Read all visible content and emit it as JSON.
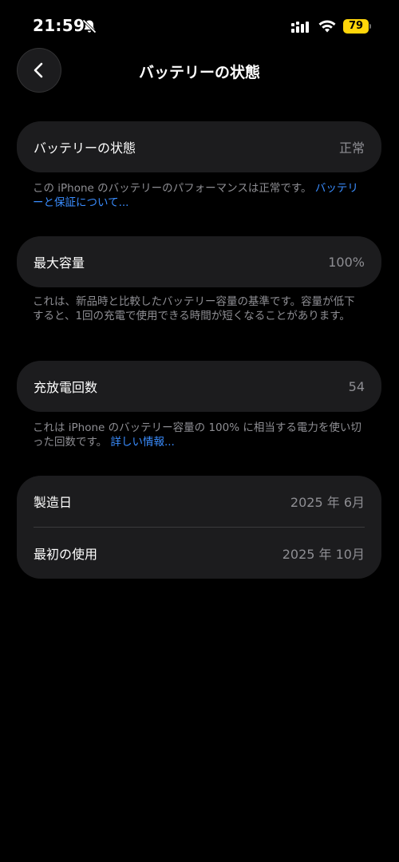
{
  "status_bar": {
    "time": "21:59",
    "battery_level": "79",
    "battery_color": "#ffd60a",
    "icons": [
      "bell-slash-icon",
      "signal-icon",
      "wifi-icon",
      "battery-icon"
    ]
  },
  "nav": {
    "back_icon": "chevron-left-icon",
    "title": "バッテリーの状態"
  },
  "sections": {
    "health": {
      "label": "バッテリーの状態",
      "value": "正常",
      "footnote_text": "この iPhone のバッテリーのパフォーマンスは正常です。",
      "footnote_link": "バッテリーと保証について..."
    },
    "capacity": {
      "label": "最大容量",
      "value": "100%",
      "footnote_text": "これは、新品時と比較したバッテリー容量の基準です。容量が低下すると、1回の充電で使用できる時間が短くなることがあります。"
    },
    "cycles": {
      "label": "充放電回数",
      "value": "54",
      "footnote_text": "これは iPhone のバッテリー容量の 100% に相当する電力を使い切った回数です。",
      "footnote_link": "詳しい情報..."
    },
    "dates": {
      "manufactured_label": "製造日",
      "manufactured_value": "2025 年 6月",
      "first_use_label": "最初の使用",
      "first_use_value": "2025 年 10月"
    }
  },
  "colors": {
    "background": "#000000",
    "card": "#1c1c1e",
    "secondary_text": "#8e8e93",
    "link": "#3a8dff"
  }
}
